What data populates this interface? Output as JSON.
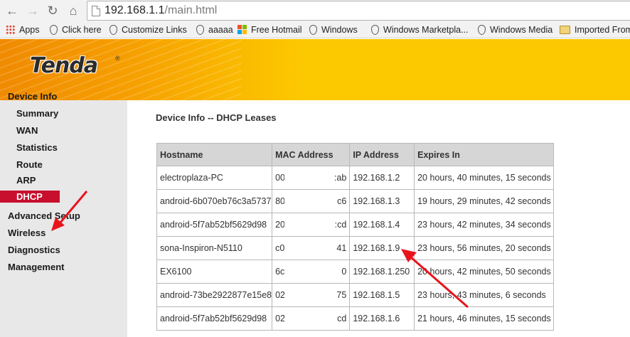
{
  "browser": {
    "url_host": "192.168.1.1",
    "url_path": "/main.html",
    "bookmarks": [
      {
        "label": "Apps",
        "icon": "apps-icon"
      },
      {
        "label": "Click here",
        "icon": "drop-icon"
      },
      {
        "label": "Customize Links",
        "icon": "drop-icon"
      },
      {
        "label": "aaaaa",
        "icon": "drop-icon"
      },
      {
        "label": "Free Hotmail",
        "icon": "ms-icon"
      },
      {
        "label": "Windows",
        "icon": "drop-icon"
      },
      {
        "label": "Windows Marketpla...",
        "icon": "drop-icon"
      },
      {
        "label": "Windows Media",
        "icon": "drop-icon"
      },
      {
        "label": "Imported From",
        "icon": "folder-icon"
      }
    ]
  },
  "brand": {
    "logo": "Tenda",
    "reg": "®",
    "banner_color": "#fcc800",
    "accent_color": "#c8102e"
  },
  "sidebar": {
    "items": [
      {
        "label": "Device Info",
        "level": "top"
      },
      {
        "label": "Summary",
        "level": "sub"
      },
      {
        "label": "WAN",
        "level": "sub"
      },
      {
        "label": "Statistics",
        "level": "sub"
      },
      {
        "label": "Route",
        "level": "sub"
      },
      {
        "label": "ARP",
        "level": "sub"
      },
      {
        "label": "DHCP",
        "level": "sub",
        "active": true
      },
      {
        "label": "Advanced Setup",
        "level": "top"
      },
      {
        "label": "Wireless",
        "level": "top"
      },
      {
        "label": "Diagnostics",
        "level": "top"
      },
      {
        "label": "Management",
        "level": "top"
      }
    ]
  },
  "main": {
    "title": "Device Info -- DHCP Leases",
    "columns": [
      "Hostname",
      "MAC Address",
      "IP Address",
      "Expires In"
    ],
    "rows": [
      {
        "hostname": "electroplaza-PC",
        "mac_prefix": "00",
        "mac_suffix": ":ab",
        "ip": "192.168.1.2",
        "expires": "20 hours, 40 minutes, 15 seconds"
      },
      {
        "hostname": "android-6b070eb76c3a5737",
        "mac_prefix": "80",
        "mac_suffix": "c6",
        "ip": "192.168.1.3",
        "expires": "19 hours, 29 minutes, 42 seconds"
      },
      {
        "hostname": "android-5f7ab52bf5629d98",
        "mac_prefix": "20",
        "mac_suffix": ":cd",
        "ip": "192.168.1.4",
        "expires": "23 hours, 42 minutes, 34 seconds"
      },
      {
        "hostname": "sona-Inspiron-N5110",
        "mac_prefix": "c0",
        "mac_suffix": "41",
        "ip": "192.168.1.9",
        "expires": "23 hours, 56 minutes, 20 seconds"
      },
      {
        "hostname": "EX6100",
        "mac_prefix": "6c",
        "mac_suffix": "0",
        "ip": "192.168.1.250",
        "expires": "20 hours, 42 minutes, 50 seconds"
      },
      {
        "hostname": "android-73be2922877e15e8",
        "mac_prefix": "02",
        "mac_suffix": "75",
        "ip": "192.168.1.5",
        "expires": "23 hours, 43 minutes, 6 seconds"
      },
      {
        "hostname": "android-5f7ab52bf5629d98",
        "mac_prefix": "02",
        "mac_suffix": "cd",
        "ip": "192.168.1.6",
        "expires": "21 hours, 46 minutes, 15 seconds"
      }
    ]
  },
  "annotation_color": "#e8141c"
}
